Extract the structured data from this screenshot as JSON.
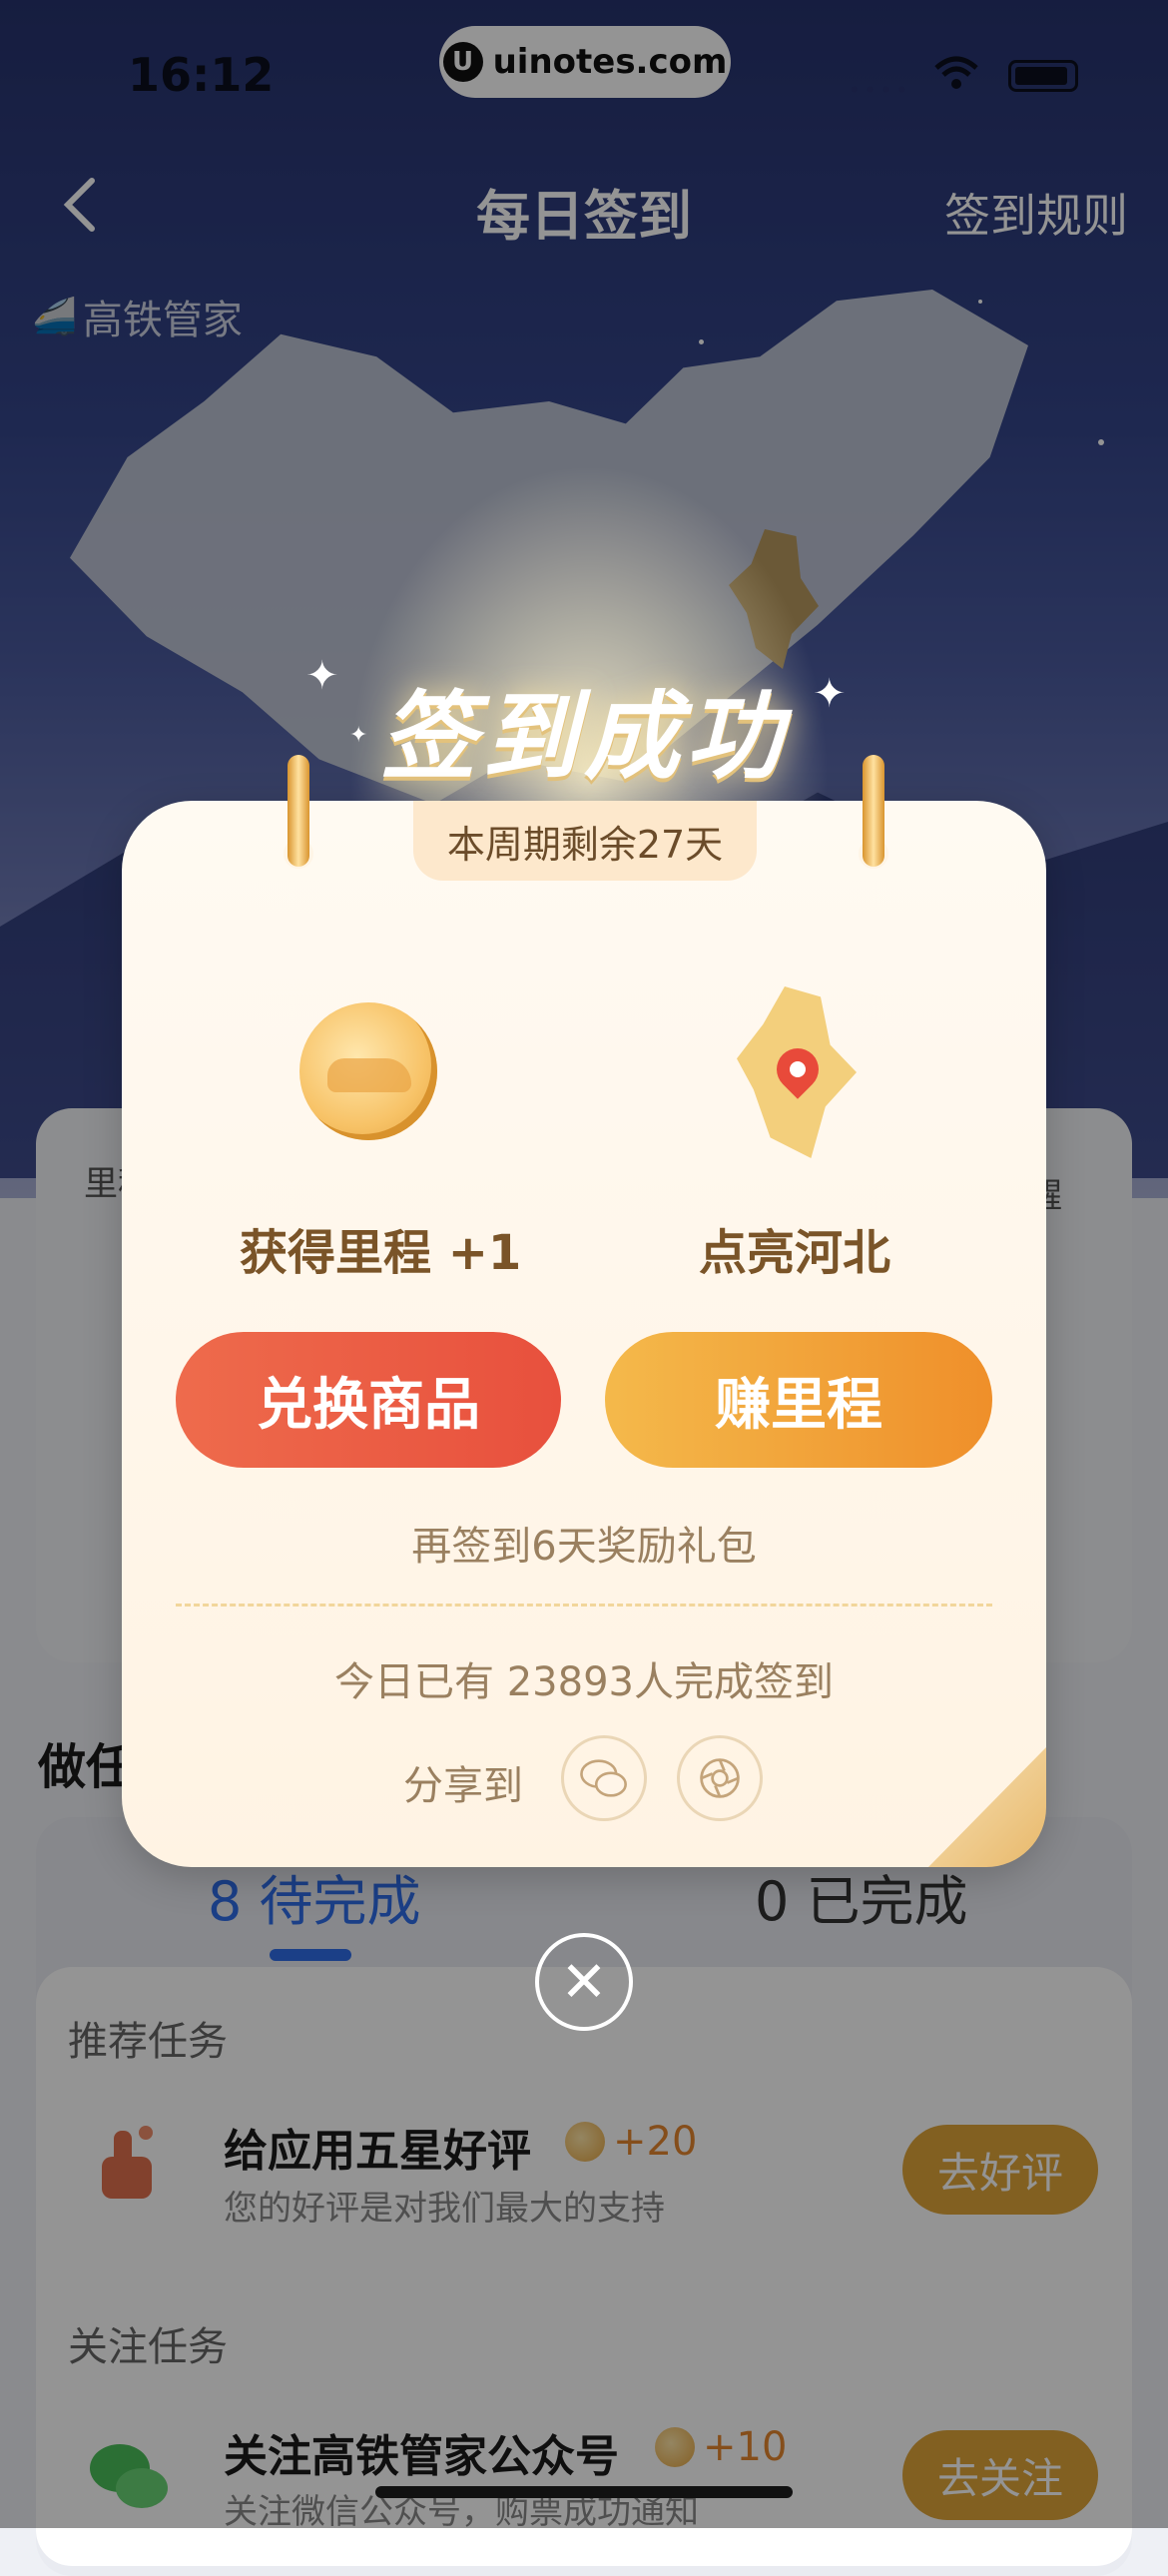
{
  "status_bar": {
    "time": "16:12",
    "site": "uinotes.com",
    "site_logo": "U"
  },
  "header": {
    "title": "每日签到",
    "rules": "签到规则",
    "brand": "高铁管家"
  },
  "underlying": {
    "card_label": "里程",
    "card_right_label": "醒",
    "section_title": "做任务",
    "tabs": [
      {
        "count": "8",
        "label": "待完成"
      },
      {
        "count": "0",
        "label": "已完成"
      }
    ],
    "groups": [
      {
        "label": "推荐任务",
        "task": {
          "title": "给应用五星好评",
          "reward": "+20",
          "subtitle": "您的好评是对我们最大的支持",
          "button": "去好评"
        }
      },
      {
        "label": "关注任务",
        "task": {
          "title": "关注高铁管家公众号",
          "reward": "+10",
          "subtitle": "关注微信公众号，购票成功通知",
          "button": "去关注"
        }
      }
    ]
  },
  "popup": {
    "headline": "签到成功",
    "period": "本周期剩余27天",
    "reward_label": "获得里程 +1",
    "light_label": "点亮河北",
    "exchange_button": "兑换商品",
    "earn_button": "赚里程",
    "bonus_text": "再签到6天奖励礼包",
    "checkin_count": "今日已有 23893人完成签到",
    "share_label": "分享到",
    "share_targets": [
      "wechat-icon",
      "moments-icon"
    ],
    "close_symbol": "✕"
  },
  "colors": {
    "accent_blue": "#2f6de8",
    "exchange_red": "#e8503d",
    "earn_orange": "#ef8f2a",
    "task_button": "#e0a53a"
  }
}
